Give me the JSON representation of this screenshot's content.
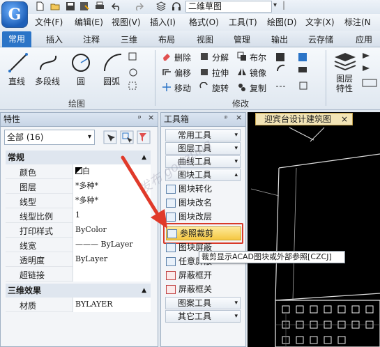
{
  "app": {
    "logo_letter": "G",
    "doc_title": "二维草图"
  },
  "menubar": [
    "文件(F)",
    "编辑(E)",
    "视图(V)",
    "插入(I)",
    "格式(O)",
    "工具(T)",
    "绘图(D)",
    "文字(X)",
    "标注(N"
  ],
  "tabs": [
    "常用",
    "插入",
    "注释",
    "三维",
    "布局",
    "视图",
    "管理",
    "输出",
    "云存储",
    "应用软"
  ],
  "ribbon": {
    "draw_tools": [
      "直线",
      "多段线",
      "圆",
      "圆弧"
    ],
    "draw_group": "绘图",
    "modify_tools": [
      "删除",
      "分解",
      "布尔",
      "偏移",
      "拉伸",
      "镜像",
      "移动",
      "旋转",
      "复制"
    ],
    "modify_group": "修改",
    "layer_props": "图层\n特性"
  },
  "properties": {
    "title": "特性",
    "selector": "全部 (16)",
    "section_general": "常规",
    "rows": [
      {
        "name": "颜色",
        "value": "白"
      },
      {
        "name": "图层",
        "value": "*多种*"
      },
      {
        "name": "线型",
        "value": "*多种*"
      },
      {
        "name": "线型比例",
        "value": "1"
      },
      {
        "name": "打印样式",
        "value": "ByColor"
      },
      {
        "name": "线宽",
        "value": "——— ByLayer"
      },
      {
        "name": "透明度",
        "value": "ByLayer"
      },
      {
        "name": "超链接",
        "value": ""
      }
    ],
    "section_3d": "三维效果",
    "rows_3d": [
      {
        "name": "材质",
        "value": "BYLAYER"
      }
    ]
  },
  "toolbox": {
    "title": "工具箱",
    "categories_top": [
      "常用工具",
      "图层工具",
      "曲线工具",
      "图块工具"
    ],
    "items": [
      "图块转化",
      "图块改名",
      "图块改层",
      "参照裁剪",
      "图块屏蔽",
      "任意屏蔽",
      "屏蔽框开",
      "屏蔽框关"
    ],
    "categories_bottom": [
      "图案工具",
      "其它工具"
    ]
  },
  "drawing": {
    "tab_title": "迎宾台设计建筑图",
    "close_glyph": "×"
  },
  "tooltip": "裁剪显示ACAD图块或外部参照[CZCJ]",
  "watermark": "发布  gongting",
  "colors": {
    "accent": "#2b74c7",
    "highlight": "#f5c842",
    "arrow": "#e03a2a"
  }
}
